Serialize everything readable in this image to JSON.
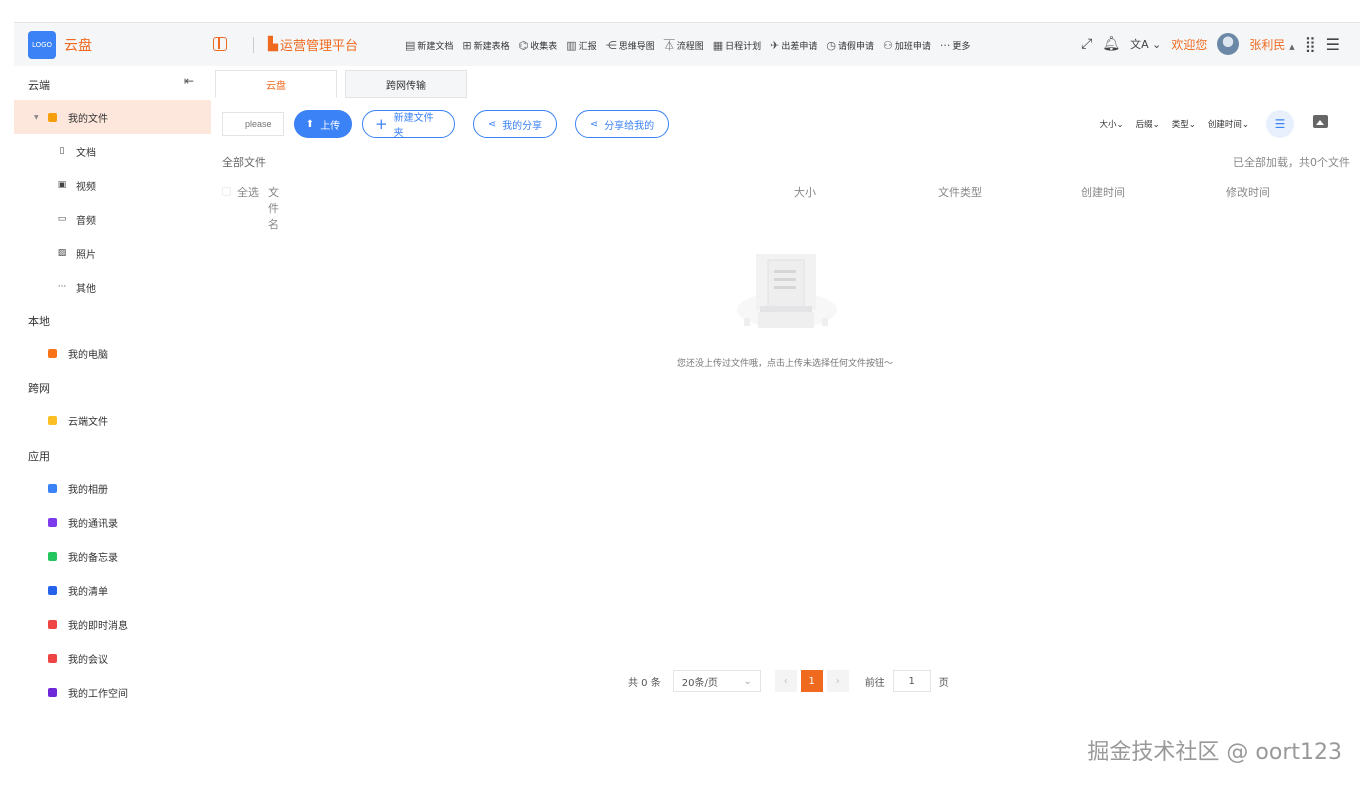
{
  "header": {
    "logo_text": "LOGO",
    "app_name": "云盘",
    "platform_title": "运营管理平台",
    "toolbar": [
      {
        "icon": "doc-icon",
        "glyph": "▤",
        "label": "新建文档"
      },
      {
        "icon": "table-icon",
        "glyph": "⊞",
        "label": "新建表格"
      },
      {
        "icon": "collect-icon",
        "glyph": "⌬",
        "label": "收集表"
      },
      {
        "icon": "report-icon",
        "glyph": "▥",
        "label": "汇报"
      },
      {
        "icon": "mindmap-icon",
        "glyph": "⋲",
        "label": "思维导图"
      },
      {
        "icon": "flow-icon",
        "glyph": "⏄",
        "label": "流程图"
      },
      {
        "icon": "calendar-icon",
        "glyph": "▦",
        "label": "日程计划"
      },
      {
        "icon": "trip-icon",
        "glyph": "✈",
        "label": "出差申请"
      },
      {
        "icon": "clock-icon",
        "glyph": "◷",
        "label": "请假申请"
      },
      {
        "icon": "overtime-icon",
        "glyph": "⚇",
        "label": "加班申请"
      },
      {
        "icon": "more-icon",
        "glyph": "···",
        "label": "更多"
      }
    ],
    "welcome": "欢迎您",
    "username": "张利民"
  },
  "sidebar": {
    "sections": {
      "cloud": "云端",
      "local": "本地",
      "cross": "跨网",
      "apps": "应用"
    },
    "my_files": "我的文件",
    "file_types": [
      {
        "icon": "document-icon",
        "glyph": "▯",
        "label": "文档"
      },
      {
        "icon": "video-icon",
        "glyph": "▣",
        "label": "视频"
      },
      {
        "icon": "audio-icon",
        "glyph": "▭",
        "label": "音频"
      },
      {
        "icon": "photo-icon",
        "glyph": "▨",
        "label": "照片"
      },
      {
        "icon": "other-icon",
        "glyph": "···",
        "label": "其他"
      }
    ],
    "my_computer": "我的电脑",
    "cloud_files": "云端文件",
    "apps": [
      {
        "icon": "album-icon",
        "color": "#3b82f6",
        "label": "我的相册"
      },
      {
        "icon": "contacts-icon",
        "color": "#7c3aed",
        "label": "我的通讯录"
      },
      {
        "icon": "memo-icon",
        "color": "#22c55e",
        "label": "我的备忘录"
      },
      {
        "icon": "checklist-icon",
        "color": "#2563eb",
        "label": "我的清单"
      },
      {
        "icon": "message-icon",
        "color": "#ef4444",
        "label": "我的即时消息"
      },
      {
        "icon": "meeting-icon",
        "color": "#ef4444",
        "label": "我的会议"
      },
      {
        "icon": "workspace-icon",
        "color": "#6d28d9",
        "label": "我的工作空间"
      }
    ]
  },
  "tabs": [
    "云盘",
    "跨网传输"
  ],
  "actions": {
    "search_placeholder": "please",
    "upload": "上传",
    "new_folder": "新建文件夹",
    "my_share": "我的分享",
    "shared_to_me": "分享给我的"
  },
  "sort_options": [
    "大小",
    "后缀",
    "类型",
    "创建时间"
  ],
  "breadcrumb": "全部文件",
  "load_status": "已全部加载，共0个文件",
  "table_headers": {
    "select_all": "全选",
    "name": "文件名",
    "size": "大小",
    "type": "文件类型",
    "created": "创建时间",
    "modified": "修改时间"
  },
  "empty_text": "您还没上传过文件哦，点击上传未选择任何文件按钮～",
  "pagination": {
    "total": "共 0 条",
    "page_size": "20条/页",
    "current": "1",
    "goto_label": "前往",
    "goto_value": "1",
    "page_suffix": "页"
  },
  "watermark": "掘金技术社区 @ oort123",
  "colors": {
    "accent": "#ef6a1f",
    "primary": "#3b82f6"
  }
}
